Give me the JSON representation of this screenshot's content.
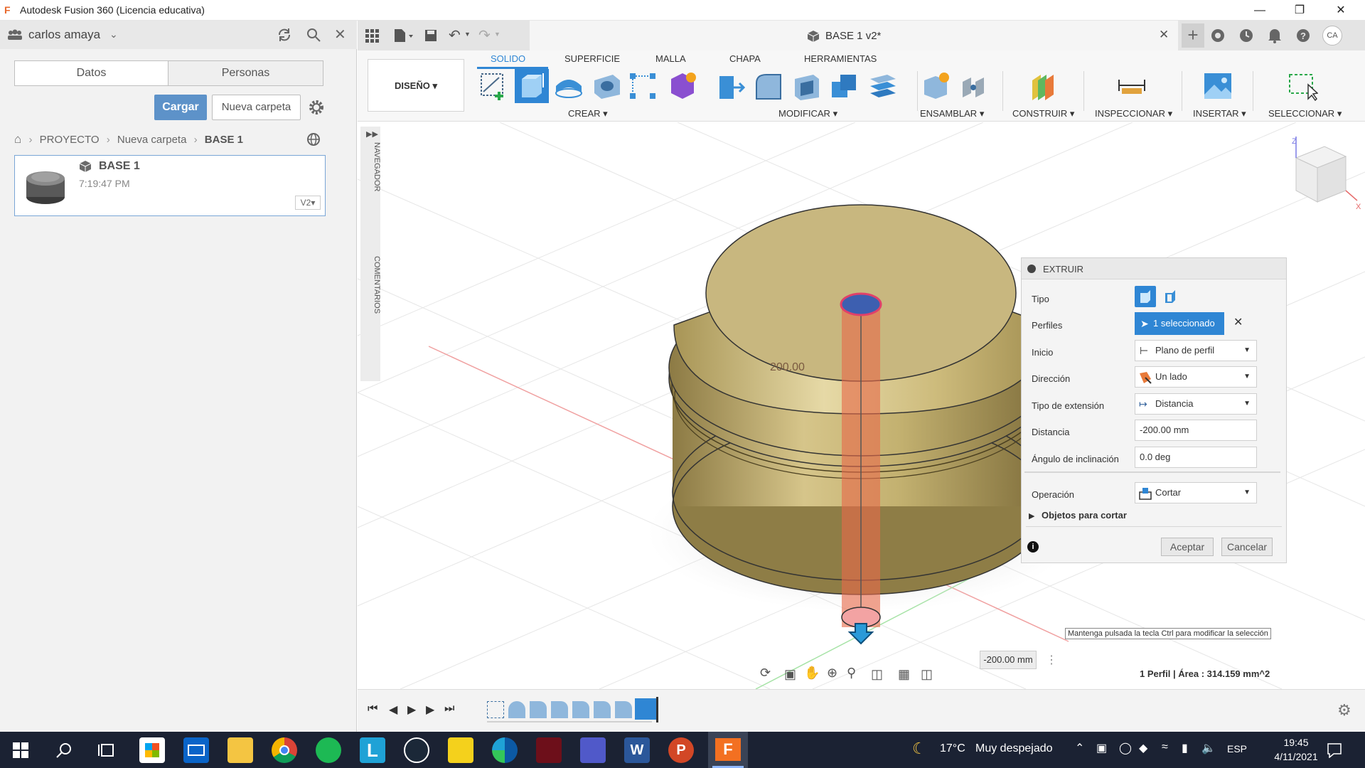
{
  "window": {
    "title": "Autodesk Fusion 360 (Licencia educativa)",
    "app_letter": "F"
  },
  "datapanel": {
    "user": "carlos amaya",
    "tabs": [
      "Datos",
      "Personas"
    ],
    "upload_label": "Cargar",
    "new_folder_label": "Nueva carpeta",
    "breadcrumb": [
      "PROYECTO",
      "Nueva carpeta",
      "BASE 1"
    ],
    "file": {
      "name": "BASE 1",
      "time": "7:19:47 PM",
      "version": "V2"
    }
  },
  "document": {
    "tab_title": "BASE 1 v2*",
    "avatar": "CA"
  },
  "ribbon": {
    "workspace": "DISEÑO",
    "tabs": [
      "SOLIDO",
      "SUPERFICIE",
      "MALLA",
      "CHAPA",
      "HERRAMIENTAS"
    ],
    "groups": [
      "CREAR",
      "MODIFICAR",
      "ENSAMBLAR",
      "CONSTRUIR",
      "INSPECCIONAR",
      "INSERTAR",
      "SELECCIONAR"
    ]
  },
  "side_strip": {
    "nav": "NAVEGADOR",
    "comments": "COMENTARIOS"
  },
  "viewport": {
    "dimension_label": "200.00",
    "hint": "Mantenga pulsada la tecla Ctrl para modificar la selección",
    "distance_input": "-200.00 mm",
    "status": "1 Perfil | Área : 314.159 mm^2"
  },
  "dialog": {
    "title": "EXTRUIR",
    "tipo_label": "Tipo",
    "perfiles_label": "Perfiles",
    "perfiles_value": "1 seleccionado",
    "inicio_label": "Inicio",
    "inicio_value": "Plano de perfil",
    "direccion_label": "Dirección",
    "direccion_value": "Un lado",
    "extension_label": "Tipo de extensión",
    "extension_value": "Distancia",
    "distancia_label": "Distancia",
    "distancia_value": "-200.00 mm",
    "angulo_label": "Ángulo de inclinación",
    "angulo_value": "0.0 deg",
    "operacion_label": "Operación",
    "operacion_value": "Cortar",
    "objetos_label": "Objetos para cortar",
    "accept_label": "Aceptar",
    "cancel_label": "Cancelar"
  },
  "taskbar": {
    "weather_temp": "17°C",
    "weather_text": "Muy despejado",
    "lang": "ESP",
    "time": "19:45",
    "date": "4/11/2021"
  }
}
